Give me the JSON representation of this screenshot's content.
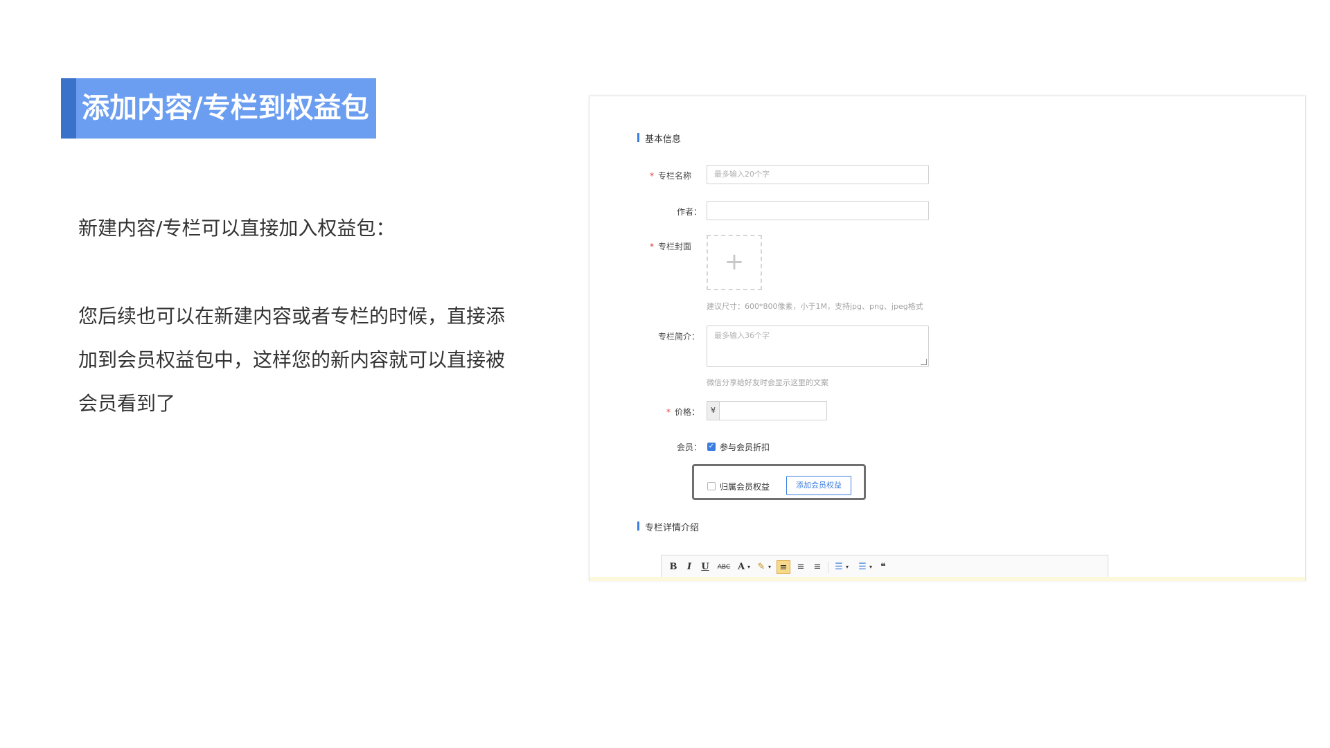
{
  "slide": {
    "title": "添加内容/专栏到权益包",
    "intro": "新建内容/专栏可以直接加入权益包：",
    "paragraph": "您后续也可以在新建内容或者专栏的时候，直接添加到会员权益包中，这样您的新内容就可以直接被会员看到了"
  },
  "form": {
    "section_basic": "基本信息",
    "name": {
      "label": "专栏名称",
      "placeholder": "最多输入20个字"
    },
    "author": {
      "label": "作者：",
      "value": ""
    },
    "cover": {
      "label": "专栏封面",
      "plus": "+",
      "hint": "建议尺寸：600*800像素，小于1M，支持jpg、png、jpeg格式"
    },
    "summary": {
      "label": "专栏简介：",
      "placeholder": "最多输入36个字",
      "hint": "微信分享给好友时会显示这里的文案"
    },
    "price": {
      "label": "价格：",
      "currency": "¥",
      "value": ""
    },
    "member": {
      "label": "会员：",
      "discount_label": "参与会员折扣",
      "discount_checked": true,
      "belong_label": "归属会员权益",
      "belong_checked": false,
      "add_button": "添加会员权益"
    },
    "required_mark": "*",
    "section_detail": "专栏详情介绍"
  },
  "toolbar": {
    "bold": "B",
    "italic": "I",
    "underline": "U",
    "strike": "ABC",
    "font_color": "A",
    "caret": "▾",
    "highlight": "✎",
    "align_left": "≡",
    "align_center": "≡",
    "align_right": "≡",
    "bullet_list": "☰",
    "ordered_list": "☰",
    "quote": "❝"
  },
  "colors": {
    "accent": "#3b7de0",
    "title_bg": "#6b9ef0",
    "title_accent": "#3a72c9",
    "required": "#e63b3b"
  }
}
